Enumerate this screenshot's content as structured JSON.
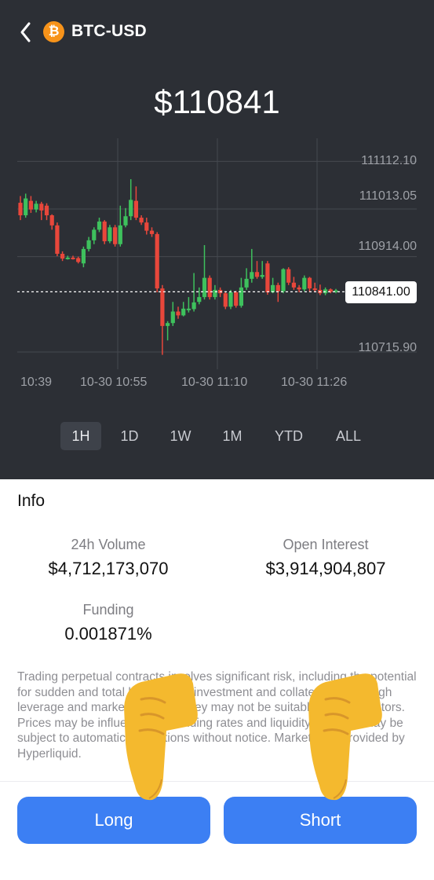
{
  "header": {
    "back_icon": "chevron-left-icon",
    "coin_icon": "bitcoin-icon",
    "coin_symbol": "₿",
    "pair": "BTC-USD"
  },
  "price": "$110841",
  "chart": {
    "y_labels": [
      "111112.10",
      "111013.05",
      "110914.00",
      "110715.90"
    ],
    "current_price_label": "110841.00",
    "x_labels": [
      "10:39",
      "10-30 10:55",
      "10-30 11:10",
      "10-30 11:26"
    ],
    "colors": {
      "up": "#3ec15d",
      "down": "#e8473b"
    }
  },
  "chart_data": {
    "type": "candlestick",
    "title": "",
    "ylim": [
      110680,
      111160
    ],
    "current_value": 110841.0,
    "up_color": "#3ec15d",
    "down_color": "#e8473b",
    "candles": [
      {
        "o": 111026,
        "c": 111000,
        "h": 111040,
        "l": 110990,
        "dir": "down"
      },
      {
        "o": 111000,
        "c": 111035,
        "h": 111045,
        "l": 110995,
        "dir": "up"
      },
      {
        "o": 111030,
        "c": 111012,
        "h": 111040,
        "l": 111005,
        "dir": "down"
      },
      {
        "o": 111012,
        "c": 111024,
        "h": 111030,
        "l": 111006,
        "dir": "up"
      },
      {
        "o": 111024,
        "c": 111010,
        "h": 111028,
        "l": 110990,
        "dir": "down"
      },
      {
        "o": 111020,
        "c": 111000,
        "h": 111025,
        "l": 110990,
        "dir": "down"
      },
      {
        "o": 111000,
        "c": 110979,
        "h": 111002,
        "l": 110970,
        "dir": "down"
      },
      {
        "o": 110979,
        "c": 110920,
        "h": 110985,
        "l": 110915,
        "dir": "down"
      },
      {
        "o": 110920,
        "c": 110910,
        "h": 110925,
        "l": 110905,
        "dir": "down"
      },
      {
        "o": 110910,
        "c": 110912,
        "h": 110916,
        "l": 110908,
        "dir": "up"
      },
      {
        "o": 110912,
        "c": 110911,
        "h": 110916,
        "l": 110908,
        "dir": "down"
      },
      {
        "o": 110911,
        "c": 110903,
        "h": 110914,
        "l": 110900,
        "dir": "down"
      },
      {
        "o": 110900,
        "c": 110930,
        "h": 110935,
        "l": 110892,
        "dir": "up"
      },
      {
        "o": 110930,
        "c": 110948,
        "h": 110955,
        "l": 110925,
        "dir": "up"
      },
      {
        "o": 110948,
        "c": 110970,
        "h": 110975,
        "l": 110940,
        "dir": "up"
      },
      {
        "o": 110970,
        "c": 110987,
        "h": 110995,
        "l": 110965,
        "dir": "up"
      },
      {
        "o": 110987,
        "c": 110946,
        "h": 110990,
        "l": 110940,
        "dir": "down"
      },
      {
        "o": 110946,
        "c": 110975,
        "h": 110980,
        "l": 110942,
        "dir": "up"
      },
      {
        "o": 110975,
        "c": 110940,
        "h": 110980,
        "l": 110935,
        "dir": "down"
      },
      {
        "o": 110940,
        "c": 110979,
        "h": 111020,
        "l": 110935,
        "dir": "up"
      },
      {
        "o": 110979,
        "c": 110998,
        "h": 111015,
        "l": 110975,
        "dir": "up"
      },
      {
        "o": 110998,
        "c": 111032,
        "h": 111075,
        "l": 110990,
        "dir": "up"
      },
      {
        "o": 111030,
        "c": 110995,
        "h": 111060,
        "l": 110990,
        "dir": "down"
      },
      {
        "o": 110995,
        "c": 110985,
        "h": 111000,
        "l": 110980,
        "dir": "down"
      },
      {
        "o": 110985,
        "c": 110968,
        "h": 110995,
        "l": 110960,
        "dir": "down"
      },
      {
        "o": 110968,
        "c": 110961,
        "h": 110975,
        "l": 110955,
        "dir": "down"
      },
      {
        "o": 110961,
        "c": 110848,
        "h": 110965,
        "l": 110840,
        "dir": "down"
      },
      {
        "o": 110848,
        "c": 110770,
        "h": 110855,
        "l": 110710,
        "dir": "down"
      },
      {
        "o": 110770,
        "c": 110776,
        "h": 110780,
        "l": 110740,
        "dir": "up"
      },
      {
        "o": 110776,
        "c": 110800,
        "h": 110820,
        "l": 110770,
        "dir": "up"
      },
      {
        "o": 110800,
        "c": 110792,
        "h": 110810,
        "l": 110785,
        "dir": "down"
      },
      {
        "o": 110792,
        "c": 110806,
        "h": 110820,
        "l": 110790,
        "dir": "up"
      },
      {
        "o": 110806,
        "c": 110805,
        "h": 110830,
        "l": 110798,
        "dir": "up"
      },
      {
        "o": 110805,
        "c": 110819,
        "h": 110880,
        "l": 110800,
        "dir": "up"
      },
      {
        "o": 110820,
        "c": 110830,
        "h": 110850,
        "l": 110815,
        "dir": "up"
      },
      {
        "o": 110830,
        "c": 110870,
        "h": 110938,
        "l": 110825,
        "dir": "up"
      },
      {
        "o": 110870,
        "c": 110830,
        "h": 110875,
        "l": 110825,
        "dir": "down"
      },
      {
        "o": 110830,
        "c": 110845,
        "h": 110855,
        "l": 110825,
        "dir": "up"
      },
      {
        "o": 110845,
        "c": 110838,
        "h": 110850,
        "l": 110830,
        "dir": "down"
      },
      {
        "o": 110838,
        "c": 110810,
        "h": 110842,
        "l": 110805,
        "dir": "down"
      },
      {
        "o": 110810,
        "c": 110840,
        "h": 110845,
        "l": 110805,
        "dir": "up"
      },
      {
        "o": 110840,
        "c": 110812,
        "h": 110843,
        "l": 110808,
        "dir": "down"
      },
      {
        "o": 110812,
        "c": 110850,
        "h": 110870,
        "l": 110808,
        "dir": "up"
      },
      {
        "o": 110850,
        "c": 110868,
        "h": 110890,
        "l": 110845,
        "dir": "up"
      },
      {
        "o": 110868,
        "c": 110882,
        "h": 110930,
        "l": 110860,
        "dir": "up"
      },
      {
        "o": 110882,
        "c": 110872,
        "h": 110905,
        "l": 110868,
        "dir": "down"
      },
      {
        "o": 110872,
        "c": 110876,
        "h": 110905,
        "l": 110868,
        "dir": "up"
      },
      {
        "o": 110900,
        "c": 110840,
        "h": 110905,
        "l": 110835,
        "dir": "down"
      },
      {
        "o": 110840,
        "c": 110855,
        "h": 110870,
        "l": 110838,
        "dir": "up"
      },
      {
        "o": 110855,
        "c": 110842,
        "h": 110860,
        "l": 110820,
        "dir": "down"
      },
      {
        "o": 110842,
        "c": 110888,
        "h": 110890,
        "l": 110838,
        "dir": "up"
      },
      {
        "o": 110888,
        "c": 110860,
        "h": 110892,
        "l": 110855,
        "dir": "down"
      },
      {
        "o": 110860,
        "c": 110850,
        "h": 110872,
        "l": 110845,
        "dir": "down"
      },
      {
        "o": 110850,
        "c": 110846,
        "h": 110855,
        "l": 110840,
        "dir": "down"
      },
      {
        "o": 110846,
        "c": 110870,
        "h": 110875,
        "l": 110842,
        "dir": "up"
      },
      {
        "o": 110870,
        "c": 110848,
        "h": 110872,
        "l": 110840,
        "dir": "down"
      },
      {
        "o": 110848,
        "c": 110845,
        "h": 110860,
        "l": 110840,
        "dir": "down"
      },
      {
        "o": 110845,
        "c": 110838,
        "h": 110856,
        "l": 110834,
        "dir": "down"
      },
      {
        "o": 110838,
        "c": 110846,
        "h": 110850,
        "l": 110834,
        "dir": "up"
      },
      {
        "o": 110846,
        "c": 110841,
        "h": 110848,
        "l": 110838,
        "dir": "down"
      },
      {
        "o": 110841,
        "c": 110844,
        "h": 110847,
        "l": 110838,
        "dir": "up"
      }
    ]
  },
  "ranges": {
    "items": [
      "1H",
      "1D",
      "1W",
      "1M",
      "YTD",
      "ALL"
    ],
    "active": "1H"
  },
  "info": {
    "title": "Info",
    "volume_label": "24h Volume",
    "volume_value": "$4,712,173,070",
    "oi_label": "Open Interest",
    "oi_value": "$3,914,904,807",
    "funding_label": "Funding",
    "funding_value": "0.001871%"
  },
  "disclaimer": "Trading perpetual contracts involves significant risk, including the potential for sudden and total loss of your investment and collateral due to high leverage and market volatility. They may not be suitable for all investors. Prices may be influenced by funding rates and liquidity, and you may be subject to automatic liquidations without notice. Market data provided by Hyperliquid.",
  "actions": {
    "long_label": "Long",
    "short_label": "Short"
  },
  "overlay": {
    "hand_icon": "pointing-down-hand-icon"
  }
}
